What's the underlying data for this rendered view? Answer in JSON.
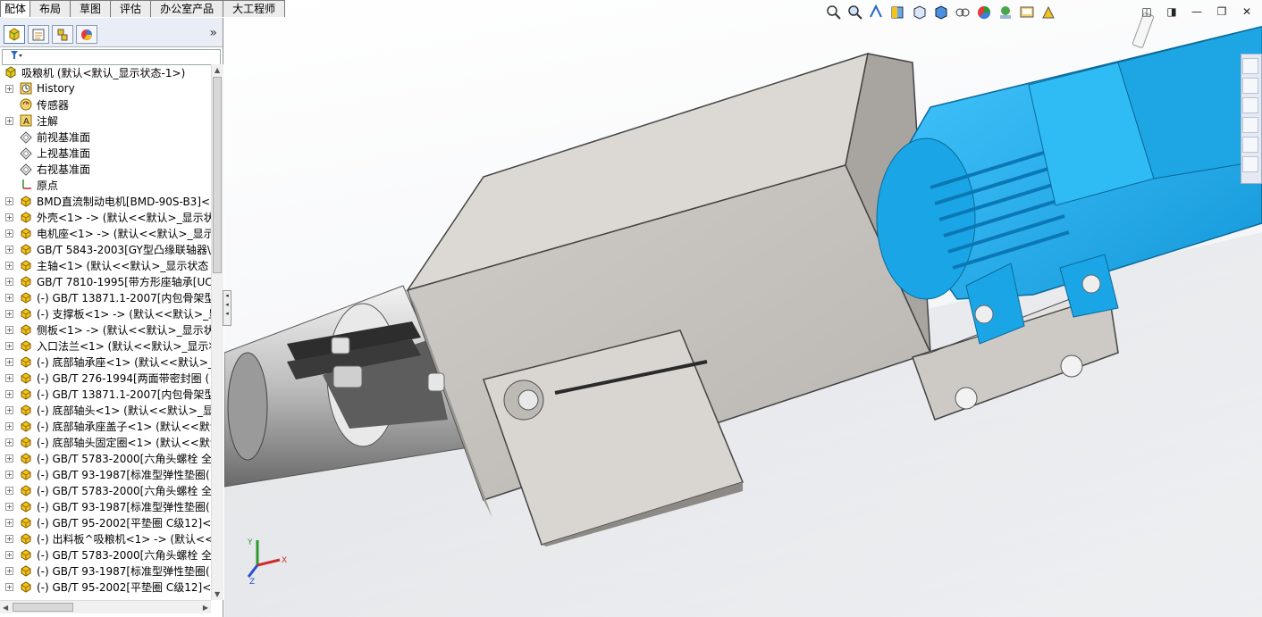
{
  "command_tabs": [
    "配体",
    "布局",
    "草图",
    "评估",
    "办公室产品",
    "大工程师"
  ],
  "pane": {
    "expand_glyph": "»",
    "filter_icon": "filter-icon"
  },
  "tree": [
    {
      "label": "吸粮机  (默认<默认_显示状态-1>)",
      "icon": "assembly-icon",
      "root": true
    },
    {
      "label": "History",
      "icon": "history-icon",
      "exp": "+"
    },
    {
      "label": "传感器",
      "icon": "sensor-icon",
      "exp": ""
    },
    {
      "label": "注解",
      "icon": "annotation-icon",
      "exp": "+"
    },
    {
      "label": "前视基准面",
      "icon": "plane-icon",
      "exp": ""
    },
    {
      "label": "上视基准面",
      "icon": "plane-icon",
      "exp": ""
    },
    {
      "label": "右视基准面",
      "icon": "plane-icon",
      "exp": ""
    },
    {
      "label": "原点",
      "icon": "origin-icon",
      "exp": ""
    },
    {
      "label": "BMD直流制动电机[BMD-90S-B3]<",
      "icon": "part-icon",
      "exp": "+"
    },
    {
      "label": "外壳<1> -> (默认<<默认>_显示状",
      "icon": "part-icon",
      "exp": "+"
    },
    {
      "label": "电机座<1> -> (默认<<默认>_显示",
      "icon": "part-icon",
      "exp": "+"
    },
    {
      "label": "GB/T 5843-2003[GY型凸缘联轴器\\",
      "icon": "part-icon",
      "exp": "+"
    },
    {
      "label": "主轴<1> (默认<<默认>_显示状态 1",
      "icon": "part-icon",
      "exp": "+"
    },
    {
      "label": "GB/T 7810-1995[带方形座轴承[UC",
      "icon": "part-icon",
      "exp": "+"
    },
    {
      "label": "(-) GB/T 13871.1-2007[内包骨架型",
      "icon": "part-icon",
      "exp": "+"
    },
    {
      "label": "(-) 支撑板<1> -> (默认<<默认>_显",
      "icon": "part-icon",
      "exp": "+"
    },
    {
      "label": "侧板<1> -> (默认<<默认>_显示状",
      "icon": "part-icon",
      "exp": "+"
    },
    {
      "label": "入口法兰<1> (默认<<默认>_显示状",
      "icon": "part-icon",
      "exp": "+"
    },
    {
      "label": "(-) 底部轴承座<1> (默认<<默认>_",
      "icon": "part-icon",
      "exp": "+"
    },
    {
      "label": "(-) GB/T 276-1994[两面带密封圈 (",
      "icon": "part-icon",
      "exp": "+"
    },
    {
      "label": "(-) GB/T 13871.1-2007[内包骨架型",
      "icon": "part-icon",
      "exp": "+"
    },
    {
      "label": "(-) 底部轴头<1> (默认<<默认>_显",
      "icon": "part-icon",
      "exp": "+"
    },
    {
      "label": "(-) 底部轴承座盖子<1> (默认<<默认",
      "icon": "part-icon",
      "exp": "+"
    },
    {
      "label": "(-) 底部轴头固定圈<1> (默认<<默认",
      "icon": "part-icon",
      "exp": "+"
    },
    {
      "label": "(-) GB/T 5783-2000[六角头螺栓 全",
      "icon": "part-icon",
      "exp": "+"
    },
    {
      "label": "(-) GB/T 93-1987[标准型弹性垫圈(",
      "icon": "part-icon",
      "exp": "+"
    },
    {
      "label": "(-) GB/T 5783-2000[六角头螺栓 全",
      "icon": "part-icon",
      "exp": "+"
    },
    {
      "label": "(-) GB/T 93-1987[标准型弹性垫圈(",
      "icon": "part-icon",
      "exp": "+"
    },
    {
      "label": "(-) GB/T 95-2002[平垫圈 C级12]<1",
      "icon": "part-icon",
      "exp": "+"
    },
    {
      "label": "(-) 出料板^吸粮机<1> -> (默认<<",
      "icon": "part-icon",
      "exp": "+"
    },
    {
      "label": "(-) GB/T 5783-2000[六角头螺栓 全",
      "icon": "part-icon",
      "exp": "+"
    },
    {
      "label": "(-) GB/T 93-1987[标准型弹性垫圈(",
      "icon": "part-icon",
      "exp": "+"
    },
    {
      "label": "(-) GB/T 95-2002[平垫圈 C级12]<1",
      "icon": "part-icon",
      "exp": "+"
    }
  ],
  "heads_up_toolbar": [
    "zoom-to-fit-icon",
    "zoom-area-icon",
    "previous-view-icon",
    "section-view-icon",
    "view-orientation-icon",
    "display-style-icon",
    "hide-show-icon",
    "appearance-icon",
    "scene-icon",
    "view-settings-icon",
    "realview-icon"
  ],
  "window_controls": [
    "restore-down-icon",
    "tile-icon",
    "minimize-icon",
    "maximize-icon",
    "close-icon"
  ],
  "window_glyphs": [
    "◫",
    "◨",
    "—",
    "❐",
    "✕"
  ],
  "task_pane": [
    "home-icon",
    "design-library-icon",
    "file-explorer-icon",
    "view-palette-icon",
    "appearances-icon",
    "custom-properties-icon"
  ],
  "triad": {
    "x": "X",
    "y": "Y",
    "z": "Z"
  },
  "colors": {
    "motor": "#1fb3f0",
    "sheet_metal": "#d8d6d2",
    "tree_icon": "#f0c419"
  }
}
